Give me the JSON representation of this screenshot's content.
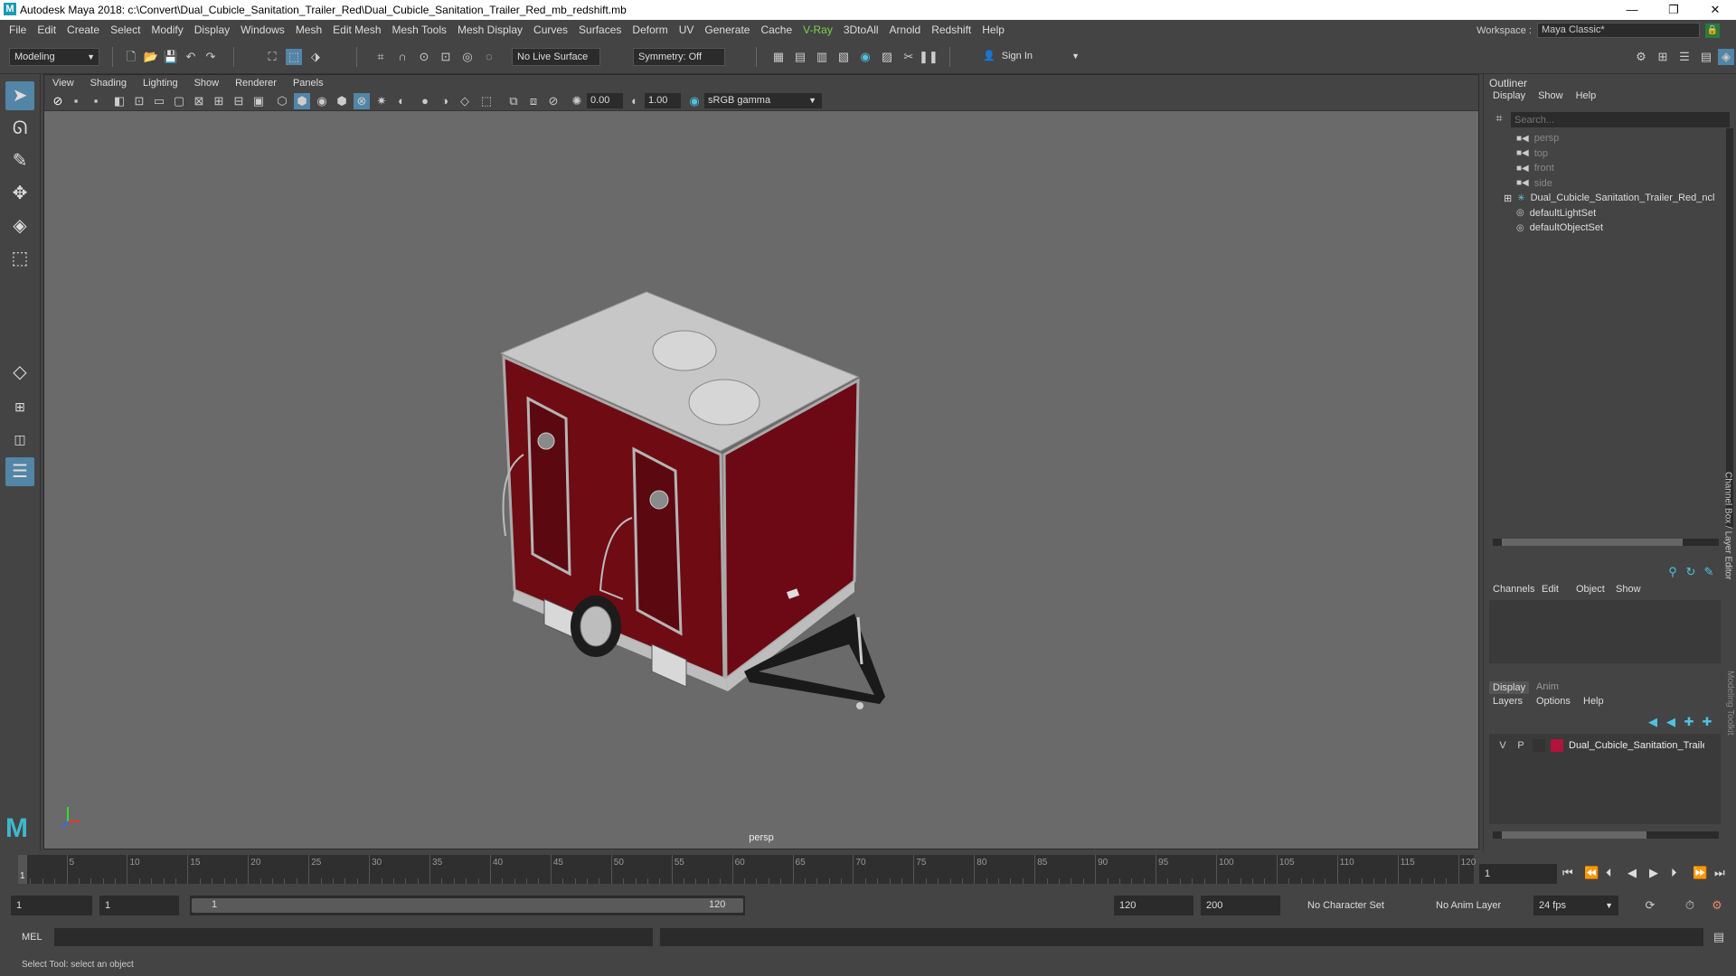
{
  "window": {
    "title": "Autodesk Maya 2018: c:\\Convert\\Dual_Cubicle_Sanitation_Trailer_Red\\Dual_Cubicle_Sanitation_Trailer_Red_mb_redshift.mb"
  },
  "menubar": {
    "items": [
      "File",
      "Edit",
      "Create",
      "Select",
      "Modify",
      "Display",
      "Windows",
      "Mesh",
      "Edit Mesh",
      "Mesh Tools",
      "Mesh Display",
      "Curves",
      "Surfaces",
      "Deform",
      "UV",
      "Generate",
      "Cache",
      "V-Ray",
      "3DtoAll",
      "Arnold",
      "Redshift",
      "Help"
    ],
    "workspace_label": "Workspace :",
    "workspace_value": "Maya Classic*"
  },
  "statusline": {
    "mode": "Modeling",
    "live_surface": "No Live Surface",
    "symmetry": "Symmetry: Off",
    "sign_in": "Sign In"
  },
  "viewport": {
    "menus": [
      "View",
      "Shading",
      "Lighting",
      "Show",
      "Renderer",
      "Panels"
    ],
    "exposure": "0.00",
    "gamma": "1.00",
    "color_space": "sRGB gamma",
    "camera": "persp"
  },
  "outliner": {
    "title": "Outliner",
    "menus": [
      "Display",
      "Show",
      "Help"
    ],
    "search_placeholder": "Search...",
    "items": [
      {
        "label": "persp",
        "icon": "camera-icon",
        "dim": true
      },
      {
        "label": "top",
        "icon": "camera-icon",
        "dim": true
      },
      {
        "label": "front",
        "icon": "camera-icon",
        "dim": true
      },
      {
        "label": "side",
        "icon": "camera-icon",
        "dim": true
      },
      {
        "label": "Dual_Cubicle_Sanitation_Trailer_Red_ncl",
        "icon": "group-icon",
        "dim": false
      },
      {
        "label": "defaultLightSet",
        "icon": "set-icon",
        "dim": false
      },
      {
        "label": "defaultObjectSet",
        "icon": "set-icon",
        "dim": false
      }
    ]
  },
  "channelbox": {
    "menus": [
      "Channels",
      "Edit",
      "Object",
      "Show"
    ],
    "side_label": "Channel Box / Layer Editor",
    "side_label2": "Modeling Toolkit",
    "layer_tabs": [
      "Display",
      "Anim"
    ],
    "layer_menus": [
      "Layers",
      "Options",
      "Help"
    ],
    "layer": {
      "v": "V",
      "p": "P",
      "name": "Dual_Cubicle_Sanitation_Traile",
      "color": "#b3123a"
    }
  },
  "timeline": {
    "ticks": [
      "5",
      "10",
      "15",
      "20",
      "25",
      "30",
      "35",
      "40",
      "45",
      "50",
      "55",
      "60",
      "65",
      "70",
      "75",
      "80",
      "85",
      "90",
      "95",
      "100",
      "105",
      "110",
      "115",
      "120"
    ],
    "current_frame": "1",
    "frame_field": "1"
  },
  "range": {
    "start": "1",
    "anim_start": "1",
    "slider_start": "1",
    "slider_end": "120",
    "end": "120",
    "anim_end": "200",
    "character_set": "No Character Set",
    "anim_layer": "No Anim Layer",
    "fps": "24 fps"
  },
  "mel": {
    "label": "MEL"
  },
  "helpline": {
    "text": "Select Tool: select an object"
  }
}
